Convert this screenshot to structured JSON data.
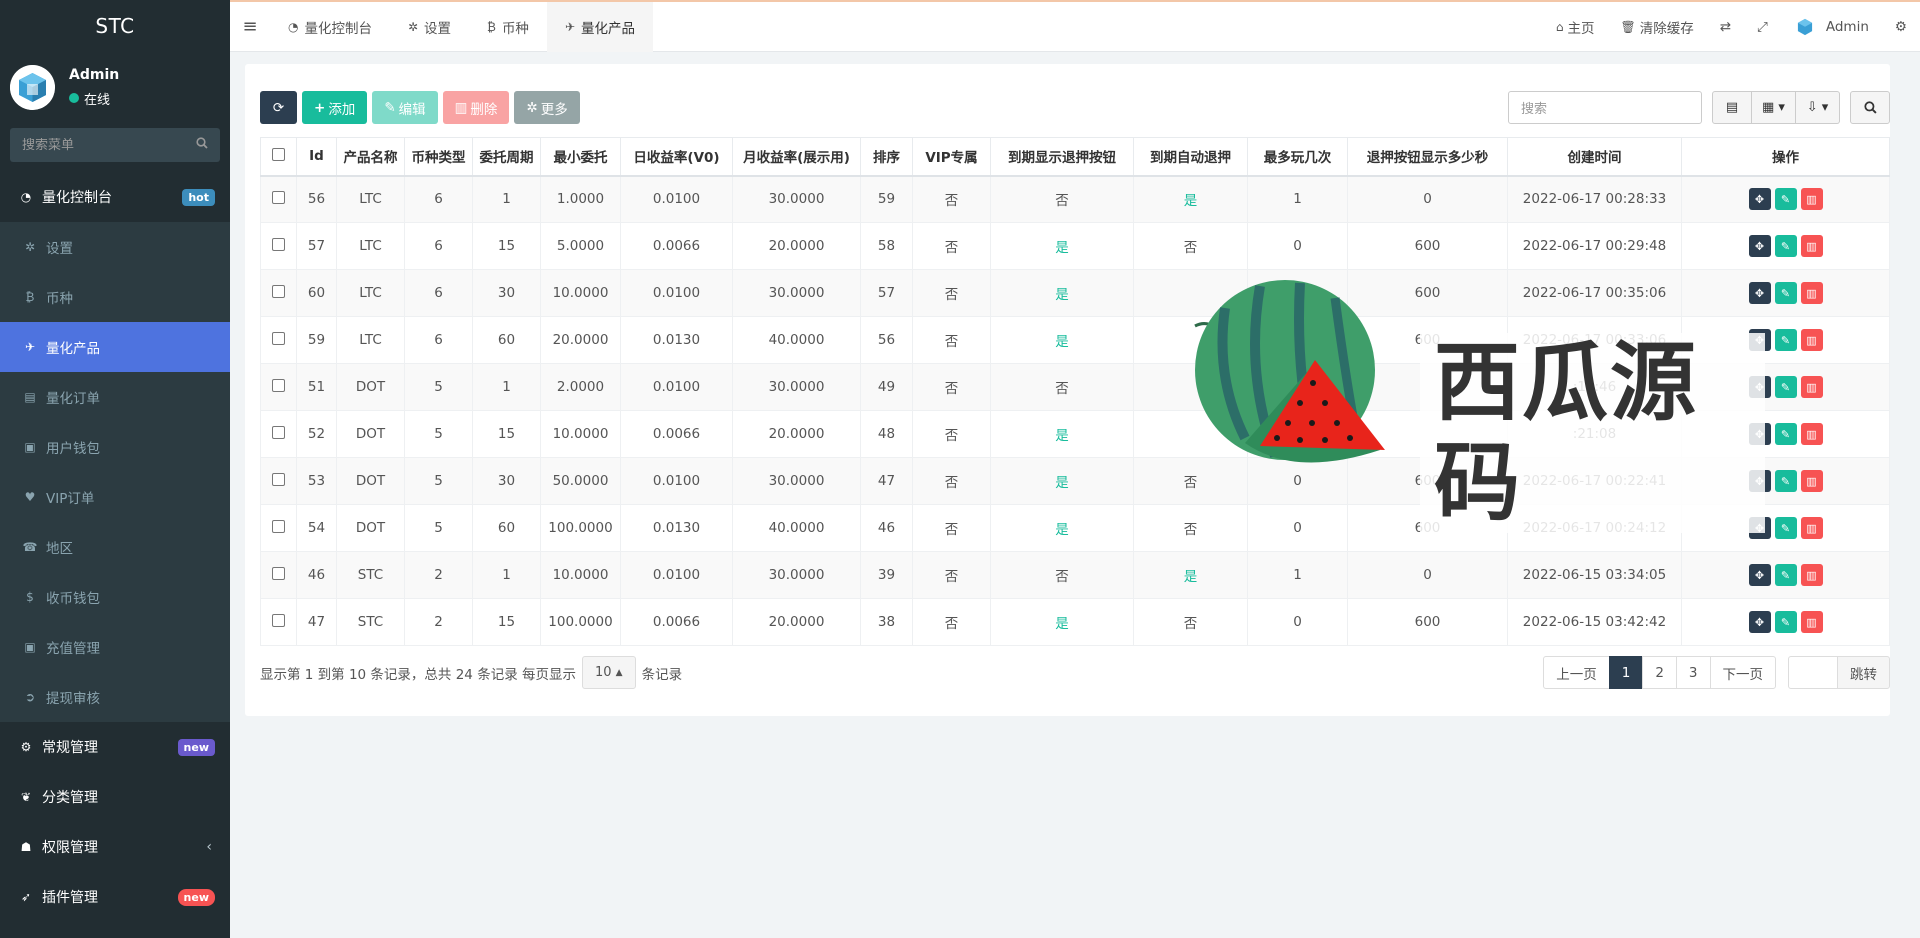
{
  "app": {
    "brand": "STC"
  },
  "user": {
    "name": "Admin",
    "status": "在线"
  },
  "sidebar": {
    "search_placeholder": "搜索菜单",
    "dashboard": {
      "label": "量化控制台",
      "badge": "hot"
    },
    "items": [
      {
        "label": "设置",
        "icon": "gear-icon"
      },
      {
        "label": "币种",
        "icon": "bitcoin-icon"
      },
      {
        "label": "量化产品",
        "icon": "plane-icon"
      },
      {
        "label": "量化订单",
        "icon": "book-icon"
      },
      {
        "label": "用户钱包",
        "icon": "money-icon"
      },
      {
        "label": "VIP订单",
        "icon": "heart-icon"
      },
      {
        "label": "地区",
        "icon": "phone-icon"
      },
      {
        "label": "收币钱包",
        "icon": "dollar-icon"
      },
      {
        "label": "充值管理",
        "icon": "money-icon"
      },
      {
        "label": "提现审核",
        "icon": "circle-arrow-icon"
      }
    ],
    "general": {
      "label": "常规管理",
      "badge": "new"
    },
    "category": {
      "label": "分类管理"
    },
    "auth": {
      "label": "权限管理"
    },
    "plugin": {
      "label": "插件管理",
      "badge": "new"
    }
  },
  "topbar": {
    "tabs": [
      "量化控制台",
      "设置",
      "币种",
      "量化产品"
    ],
    "home": "主页",
    "clear_cache": "清除缓存",
    "admin": "Admin"
  },
  "toolbar": {
    "add": "添加",
    "edit": "编辑",
    "delete": "删除",
    "more": "更多",
    "search_placeholder": "搜索"
  },
  "table": {
    "headers": [
      "Id",
      "产品名称",
      "币种类型",
      "委托周期",
      "最小委托",
      "日收益率(V0)",
      "月收益率(展示用)",
      "排序",
      "VIP专属",
      "到期显示退押按钮",
      "到期自动退押",
      "最多玩几次",
      "退押按钮显示多少秒",
      "创建时间",
      "操作"
    ],
    "rows": [
      [
        "56",
        "LTC",
        "6",
        "1",
        "1.0000",
        "0.0100",
        "30.0000",
        "59",
        "否",
        "否",
        "是",
        "1",
        "0",
        "2022-06-17 00:28:33"
      ],
      [
        "57",
        "LTC",
        "6",
        "15",
        "5.0000",
        "0.0066",
        "20.0000",
        "58",
        "否",
        "是",
        "否",
        "0",
        "600",
        "2022-06-17 00:29:48"
      ],
      [
        "60",
        "LTC",
        "6",
        "30",
        "10.0000",
        "0.0100",
        "30.0000",
        "57",
        "否",
        "是",
        "",
        "0",
        "600",
        "2022-06-17 00:35:06"
      ],
      [
        "59",
        "LTC",
        "6",
        "60",
        "20.0000",
        "0.0130",
        "40.0000",
        "56",
        "否",
        "是",
        "",
        "0",
        "600",
        "2022-06-17 00:33:06"
      ],
      [
        "51",
        "DOT",
        "5",
        "1",
        "2.0000",
        "0.0100",
        "30.0000",
        "49",
        "否",
        "否",
        "",
        "",
        "",
        ":19:46"
      ],
      [
        "52",
        "DOT",
        "5",
        "15",
        "10.0000",
        "0.0066",
        "20.0000",
        "48",
        "否",
        "是",
        "",
        "",
        "",
        ":21:08"
      ],
      [
        "53",
        "DOT",
        "5",
        "30",
        "50.0000",
        "0.0100",
        "30.0000",
        "47",
        "否",
        "是",
        "否",
        "0",
        "600",
        "2022-06-17 00:22:41"
      ],
      [
        "54",
        "DOT",
        "5",
        "60",
        "100.0000",
        "0.0130",
        "40.0000",
        "46",
        "否",
        "是",
        "否",
        "0",
        "600",
        "2022-06-17 00:24:12"
      ],
      [
        "46",
        "STC",
        "2",
        "1",
        "10.0000",
        "0.0100",
        "30.0000",
        "39",
        "否",
        "否",
        "是",
        "1",
        "0",
        "2022-06-15 03:34:05"
      ],
      [
        "47",
        "STC",
        "2",
        "15",
        "100.0000",
        "0.0066",
        "20.0000",
        "38",
        "否",
        "是",
        "否",
        "0",
        "600",
        "2022-06-15 03:42:42"
      ]
    ]
  },
  "pagination": {
    "info_prefix": "显示第 1 到第 10 条记录，总共 24 条记录 每页显示",
    "page_size": "10",
    "info_suffix": "条记录",
    "prev": "上一页",
    "pages": [
      "1",
      "2",
      "3"
    ],
    "next": "下一页",
    "jump": "跳转"
  },
  "watermark": {
    "text": "西瓜源码"
  },
  "colors": {
    "sidebar_bg": "#222d32",
    "active_menu": "#4e73df",
    "primary": "#18bc9c",
    "danger": "#f75353",
    "dark": "#2c3e50"
  }
}
